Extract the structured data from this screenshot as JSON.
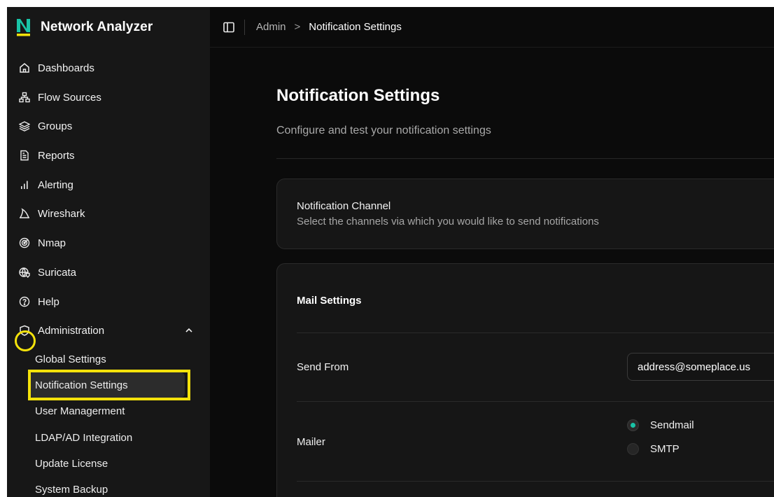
{
  "app": {
    "name": "Network Analyzer"
  },
  "sidebar": {
    "items": [
      {
        "label": "Dashboards",
        "icon": "home-icon"
      },
      {
        "label": "Flow Sources",
        "icon": "network-icon"
      },
      {
        "label": "Groups",
        "icon": "layers-icon"
      },
      {
        "label": "Reports",
        "icon": "document-icon"
      },
      {
        "label": "Alerting",
        "icon": "bar-signal-icon"
      },
      {
        "label": "Wireshark",
        "icon": "shark-fin-icon"
      },
      {
        "label": "Nmap",
        "icon": "radar-icon"
      },
      {
        "label": "Suricata",
        "icon": "globe-shield-icon"
      },
      {
        "label": "Help",
        "icon": "help-circle-icon"
      },
      {
        "label": "Administration",
        "icon": "shield-icon",
        "expanded": true
      }
    ],
    "admin_sub": [
      {
        "label": "Global Settings"
      },
      {
        "label": "Notification Settings",
        "active": true
      },
      {
        "label": "User Managerment"
      },
      {
        "label": "LDAP/AD Integration"
      },
      {
        "label": "Update License"
      },
      {
        "label": "System Backup"
      }
    ]
  },
  "breadcrumb": {
    "parent": "Admin",
    "separator": ">",
    "current": "Notification Settings"
  },
  "page": {
    "title": "Notification Settings",
    "subtitle": "Configure and test your notification settings"
  },
  "channel_card": {
    "title": "Notification Channel",
    "subtitle": "Select the channels via which you would like to send notifications"
  },
  "mail_card": {
    "title": "Mail Settings",
    "send_from_label": "Send From",
    "send_from_value": "address@someplace.us",
    "mailer_label": "Mailer",
    "mailer_options": [
      {
        "label": "Sendmail",
        "selected": true
      },
      {
        "label": "SMTP",
        "selected": false
      }
    ]
  },
  "colors": {
    "accent": "#19c3a6",
    "highlight": "#f4e20b",
    "sidebar_bg": "#171717",
    "main_bg": "#0b0b0b"
  }
}
